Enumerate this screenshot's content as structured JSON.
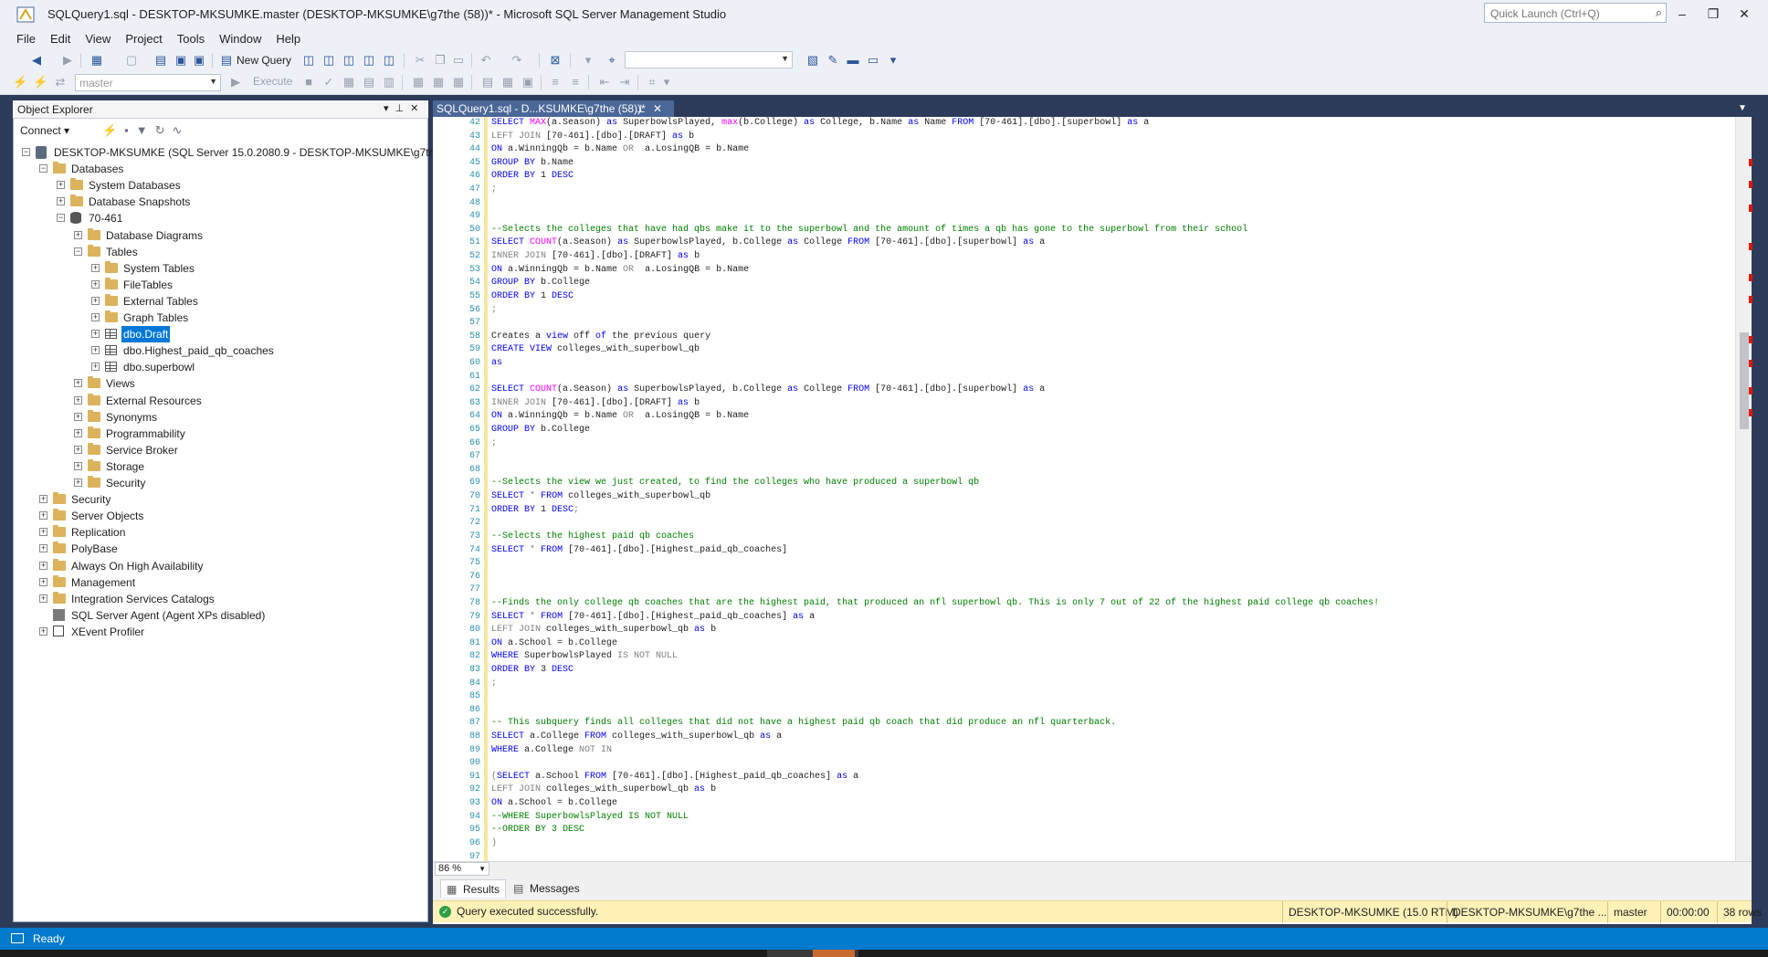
{
  "window": {
    "title": "SQLQuery1.sql - DESKTOP-MKSUMKE.master (DESKTOP-MKSUMKE\\g7the (58))* - Microsoft SQL Server Management Studio",
    "quick_launch_placeholder": "Quick Launch (Ctrl+Q)"
  },
  "menu": [
    "File",
    "Edit",
    "View",
    "Project",
    "Tools",
    "Window",
    "Help"
  ],
  "toolbar": {
    "new_query": "New Query",
    "database_combo": "master",
    "execute": "Execute"
  },
  "object_explorer": {
    "title": "Object Explorer",
    "connect": "Connect",
    "tree": [
      {
        "label": "DESKTOP-MKSUMKE (SQL Server 15.0.2080.9 - DESKTOP-MKSUMKE\\g7the)",
        "icon": "server-icon",
        "depth": 0,
        "expander": "−"
      },
      {
        "label": "Databases",
        "icon": "folder-icon",
        "depth": 1,
        "expander": "−"
      },
      {
        "label": "System Databases",
        "icon": "folder-icon",
        "depth": 2,
        "expander": "+"
      },
      {
        "label": "Database Snapshots",
        "icon": "folder-icon",
        "depth": 2,
        "expander": "+"
      },
      {
        "label": "70-461",
        "icon": "database-icon",
        "depth": 2,
        "expander": "−"
      },
      {
        "label": "Database Diagrams",
        "icon": "folder-icon",
        "depth": 3,
        "expander": "+"
      },
      {
        "label": "Tables",
        "icon": "folder-icon",
        "depth": 3,
        "expander": "−"
      },
      {
        "label": "System Tables",
        "icon": "folder-icon",
        "depth": 4,
        "expander": "+"
      },
      {
        "label": "FileTables",
        "icon": "folder-icon",
        "depth": 4,
        "expander": "+"
      },
      {
        "label": "External Tables",
        "icon": "folder-icon",
        "depth": 4,
        "expander": "+"
      },
      {
        "label": "Graph Tables",
        "icon": "folder-icon",
        "depth": 4,
        "expander": "+"
      },
      {
        "label": "dbo.Draft",
        "icon": "table-icon",
        "depth": 4,
        "expander": "+",
        "selected": true
      },
      {
        "label": "dbo.Highest_paid_qb_coaches",
        "icon": "table-icon",
        "depth": 4,
        "expander": "+"
      },
      {
        "label": "dbo.superbowl",
        "icon": "table-icon",
        "depth": 4,
        "expander": "+"
      },
      {
        "label": "Views",
        "icon": "folder-icon",
        "depth": 3,
        "expander": "+"
      },
      {
        "label": "External Resources",
        "icon": "folder-icon",
        "depth": 3,
        "expander": "+"
      },
      {
        "label": "Synonyms",
        "icon": "folder-icon",
        "depth": 3,
        "expander": "+"
      },
      {
        "label": "Programmability",
        "icon": "folder-icon",
        "depth": 3,
        "expander": "+"
      },
      {
        "label": "Service Broker",
        "icon": "folder-icon",
        "depth": 3,
        "expander": "+"
      },
      {
        "label": "Storage",
        "icon": "folder-icon",
        "depth": 3,
        "expander": "+"
      },
      {
        "label": "Security",
        "icon": "folder-icon",
        "depth": 3,
        "expander": "+"
      },
      {
        "label": "Security",
        "icon": "folder-icon",
        "depth": 1,
        "expander": "+"
      },
      {
        "label": "Server Objects",
        "icon": "folder-icon",
        "depth": 1,
        "expander": "+"
      },
      {
        "label": "Replication",
        "icon": "folder-icon",
        "depth": 1,
        "expander": "+"
      },
      {
        "label": "PolyBase",
        "icon": "folder-icon",
        "depth": 1,
        "expander": "+"
      },
      {
        "label": "Always On High Availability",
        "icon": "folder-icon",
        "depth": 1,
        "expander": "+"
      },
      {
        "label": "Management",
        "icon": "folder-icon",
        "depth": 1,
        "expander": "+"
      },
      {
        "label": "Integration Services Catalogs",
        "icon": "folder-icon",
        "depth": 1,
        "expander": "+"
      },
      {
        "label": "SQL Server Agent (Agent XPs disabled)",
        "icon": "agent-icon",
        "depth": 1,
        "expander": ""
      },
      {
        "label": "XEvent Profiler",
        "icon": "xevent-icon",
        "depth": 1,
        "expander": "+"
      }
    ]
  },
  "editor": {
    "tab_title": "SQLQuery1.sql - D...KSUMKE\\g7the (58))*",
    "zoom": "86 %",
    "lines": [
      {
        "n": "42",
        "html": "<span class=\"kw\">SELECT</span> <span class=\"fn\">MAX</span>(a.Season) <span class=\"kw\">as</span> SuperbowlsPlayed, <span class=\"fn\">max</span>(b.College) <span class=\"kw\">as</span> College, b.Name <span class=\"kw\">as</span> Name <span class=\"kw\">FROM</span> [70-461].[dbo].[superbowl] <span class=\"kw\">as</span> a"
      },
      {
        "n": "43",
        "html": "<span class=\"gr\">LEFT JOIN</span> [70-461].[dbo].[DRAFT] <span class=\"kw\">as</span> b"
      },
      {
        "n": "44",
        "html": "<span class=\"kw\">ON</span> a.WinningQb = b.Name <span class=\"gr\">OR</span>  a.LosingQB = b.Name"
      },
      {
        "n": "45",
        "html": "<span class=\"kw\">GROUP BY</span> b.Name"
      },
      {
        "n": "46",
        "html": "<span class=\"kw\">ORDER BY</span> 1 <span class=\"kw\">DESC</span>"
      },
      {
        "n": "47",
        "html": "<span class=\"gr\">;</span>"
      },
      {
        "n": "48",
        "html": ""
      },
      {
        "n": "49",
        "html": ""
      },
      {
        "n": "50",
        "html": "<span class=\"cm\">--Selects the colleges that have had qbs make it to the superbowl and the amount of times a qb has gone to the superbowl from their school</span>"
      },
      {
        "n": "51",
        "html": "<span class=\"kw\">SELECT</span> <span class=\"fn\">COUNT</span>(a.Season) <span class=\"kw\">as</span> SuperbowlsPlayed, b.College <span class=\"kw\">as</span> College <span class=\"kw\">FROM</span> [70-461].[dbo].[superbowl] <span class=\"kw\">as</span> a"
      },
      {
        "n": "52",
        "html": "<span class=\"gr\">INNER JOIN</span> [70-461].[dbo].[DRAFT] <span class=\"kw\">as</span> b"
      },
      {
        "n": "53",
        "html": "<span class=\"kw\">ON</span> a.WinningQb = b.Name <span class=\"gr\">OR</span>  a.LosingQB = b.Name"
      },
      {
        "n": "54",
        "html": "<span class=\"kw\">GROUP BY</span> b.College"
      },
      {
        "n": "55",
        "html": "<span class=\"kw\">ORDER BY</span> 1 <span class=\"kw\">DESC</span>"
      },
      {
        "n": "56",
        "html": "<span class=\"gr\">;</span>"
      },
      {
        "n": "57",
        "html": ""
      },
      {
        "n": "58",
        "html": "Creates a <span class=\"kw\">view</span> off <span class=\"kw\">of</span> the previous query"
      },
      {
        "n": "59",
        "html": "<span class=\"kw\">CREATE VIEW</span> colleges_with_superbowl_qb"
      },
      {
        "n": "60",
        "html": "<span class=\"kw\">as</span>"
      },
      {
        "n": "61",
        "html": ""
      },
      {
        "n": "62",
        "html": "<span class=\"kw\">SELECT</span> <span class=\"fn\">COUNT</span>(a.Season) <span class=\"kw\">as</span> SuperbowlsPlayed, b.College <span class=\"kw\">as</span> College <span class=\"kw\">FROM</span> [70-461].[dbo].[superbowl] <span class=\"kw\">as</span> a"
      },
      {
        "n": "63",
        "html": "<span class=\"gr\">INNER JOIN</span> [70-461].[dbo].[DRAFT] <span class=\"kw\">as</span> b"
      },
      {
        "n": "64",
        "html": "<span class=\"kw\">ON</span> a.WinningQb = b.Name <span class=\"gr\">OR</span>  a.LosingQB = b.Name"
      },
      {
        "n": "65",
        "html": "<span class=\"kw\">GROUP BY</span> b.College"
      },
      {
        "n": "66",
        "html": "<span class=\"gr\">;</span>"
      },
      {
        "n": "67",
        "html": ""
      },
      {
        "n": "68",
        "html": ""
      },
      {
        "n": "69",
        "html": "<span class=\"cm\">--Selects the view we just created, to find the colleges who have produced a superbowl qb</span>"
      },
      {
        "n": "70",
        "html": "<span class=\"kw\">SELECT</span> <span class=\"gr\">*</span> <span class=\"kw\">FROM</span> colleges_with_superbowl_qb"
      },
      {
        "n": "71",
        "html": "<span class=\"kw\">ORDER BY</span> 1 <span class=\"kw\">DESC</span><span class=\"gr\">;</span>"
      },
      {
        "n": "72",
        "html": ""
      },
      {
        "n": "73",
        "html": "<span class=\"cm\">--Selects the highest paid qb coaches</span>"
      },
      {
        "n": "74",
        "html": "<span class=\"kw\">SELECT</span> <span class=\"gr\">*</span> <span class=\"kw\">FROM</span> [70-461].[dbo].[Highest_paid_qb_coaches]"
      },
      {
        "n": "75",
        "html": ""
      },
      {
        "n": "76",
        "html": ""
      },
      {
        "n": "77",
        "html": ""
      },
      {
        "n": "78",
        "html": "<span class=\"cm\">--Finds the only college qb coaches that are the highest paid, that produced an nfl superbowl qb. This is only 7 out of 22 of the highest paid college qb coaches!</span>"
      },
      {
        "n": "79",
        "html": "<span class=\"kw\">SELECT</span> <span class=\"gr\">*</span> <span class=\"kw\">FROM</span> [70-461].[dbo].[Highest_paid_qb_coaches] <span class=\"kw\">as</span> a"
      },
      {
        "n": "80",
        "html": "<span class=\"gr\">LEFT JOIN</span> colleges_with_superbowl_qb <span class=\"kw\">as</span> b"
      },
      {
        "n": "81",
        "html": "<span class=\"kw\">ON</span> a.School = b.College"
      },
      {
        "n": "82",
        "html": "<span class=\"kw\">WHERE</span> SuperbowlsPlayed <span class=\"gr\">IS NOT NULL</span>"
      },
      {
        "n": "83",
        "html": "<span class=\"kw\">ORDER BY</span> 3 <span class=\"kw\">DESC</span>"
      },
      {
        "n": "84",
        "html": "<span class=\"gr\">;</span>"
      },
      {
        "n": "85",
        "html": ""
      },
      {
        "n": "86",
        "html": ""
      },
      {
        "n": "87",
        "html": "<span class=\"cm\">-- This subquery finds all colleges that did not have a highest paid qb coach that did produce an nfl quarterback.</span>"
      },
      {
        "n": "88",
        "html": "<span class=\"kw\">SELECT</span> a.College <span class=\"kw\">FROM</span> colleges_with_superbowl_qb <span class=\"kw\">as</span> a"
      },
      {
        "n": "89",
        "html": "<span class=\"kw\">WHERE</span> a.College <span class=\"gr\">NOT IN</span>"
      },
      {
        "n": "90",
        "html": ""
      },
      {
        "n": "91",
        "html": "<span class=\"gr\">(</span><span class=\"kw\">SELECT</span> a.School <span class=\"kw\">FROM</span> [70-461].[dbo].[Highest_paid_qb_coaches] <span class=\"kw\">as</span> a"
      },
      {
        "n": "92",
        "html": "<span class=\"gr\">LEFT JOIN</span> colleges_with_superbowl_qb <span class=\"kw\">as</span> b"
      },
      {
        "n": "93",
        "html": "<span class=\"kw\">ON</span> a.School = b.College"
      },
      {
        "n": "94",
        "html": "<span class=\"cm\">--WHERE SuperbowlsPlayed IS NOT NULL</span>"
      },
      {
        "n": "95",
        "html": "<span class=\"cm\">--ORDER BY 3 DESC</span>"
      },
      {
        "n": "96",
        "html": "<span class=\"gr\">)</span>"
      },
      {
        "n": "97",
        "html": ""
      }
    ]
  },
  "results": {
    "tab_results": "Results",
    "tab_messages": "Messages",
    "status_message": "Query executed successfully.",
    "server": "DESKTOP-MKSUMKE (15.0 RTM)",
    "user": "DESKTOP-MKSUMKE\\g7the ...",
    "database": "master",
    "elapsed": "00:00:00",
    "rows": "38 rows"
  },
  "statusbar": {
    "text": "Ready"
  },
  "colors": {
    "keyword": "#0000ff",
    "function": "#ff00ff",
    "comment": "#008000",
    "status_bar": "#007acc",
    "exec_status_bg": "#fff1b8"
  }
}
